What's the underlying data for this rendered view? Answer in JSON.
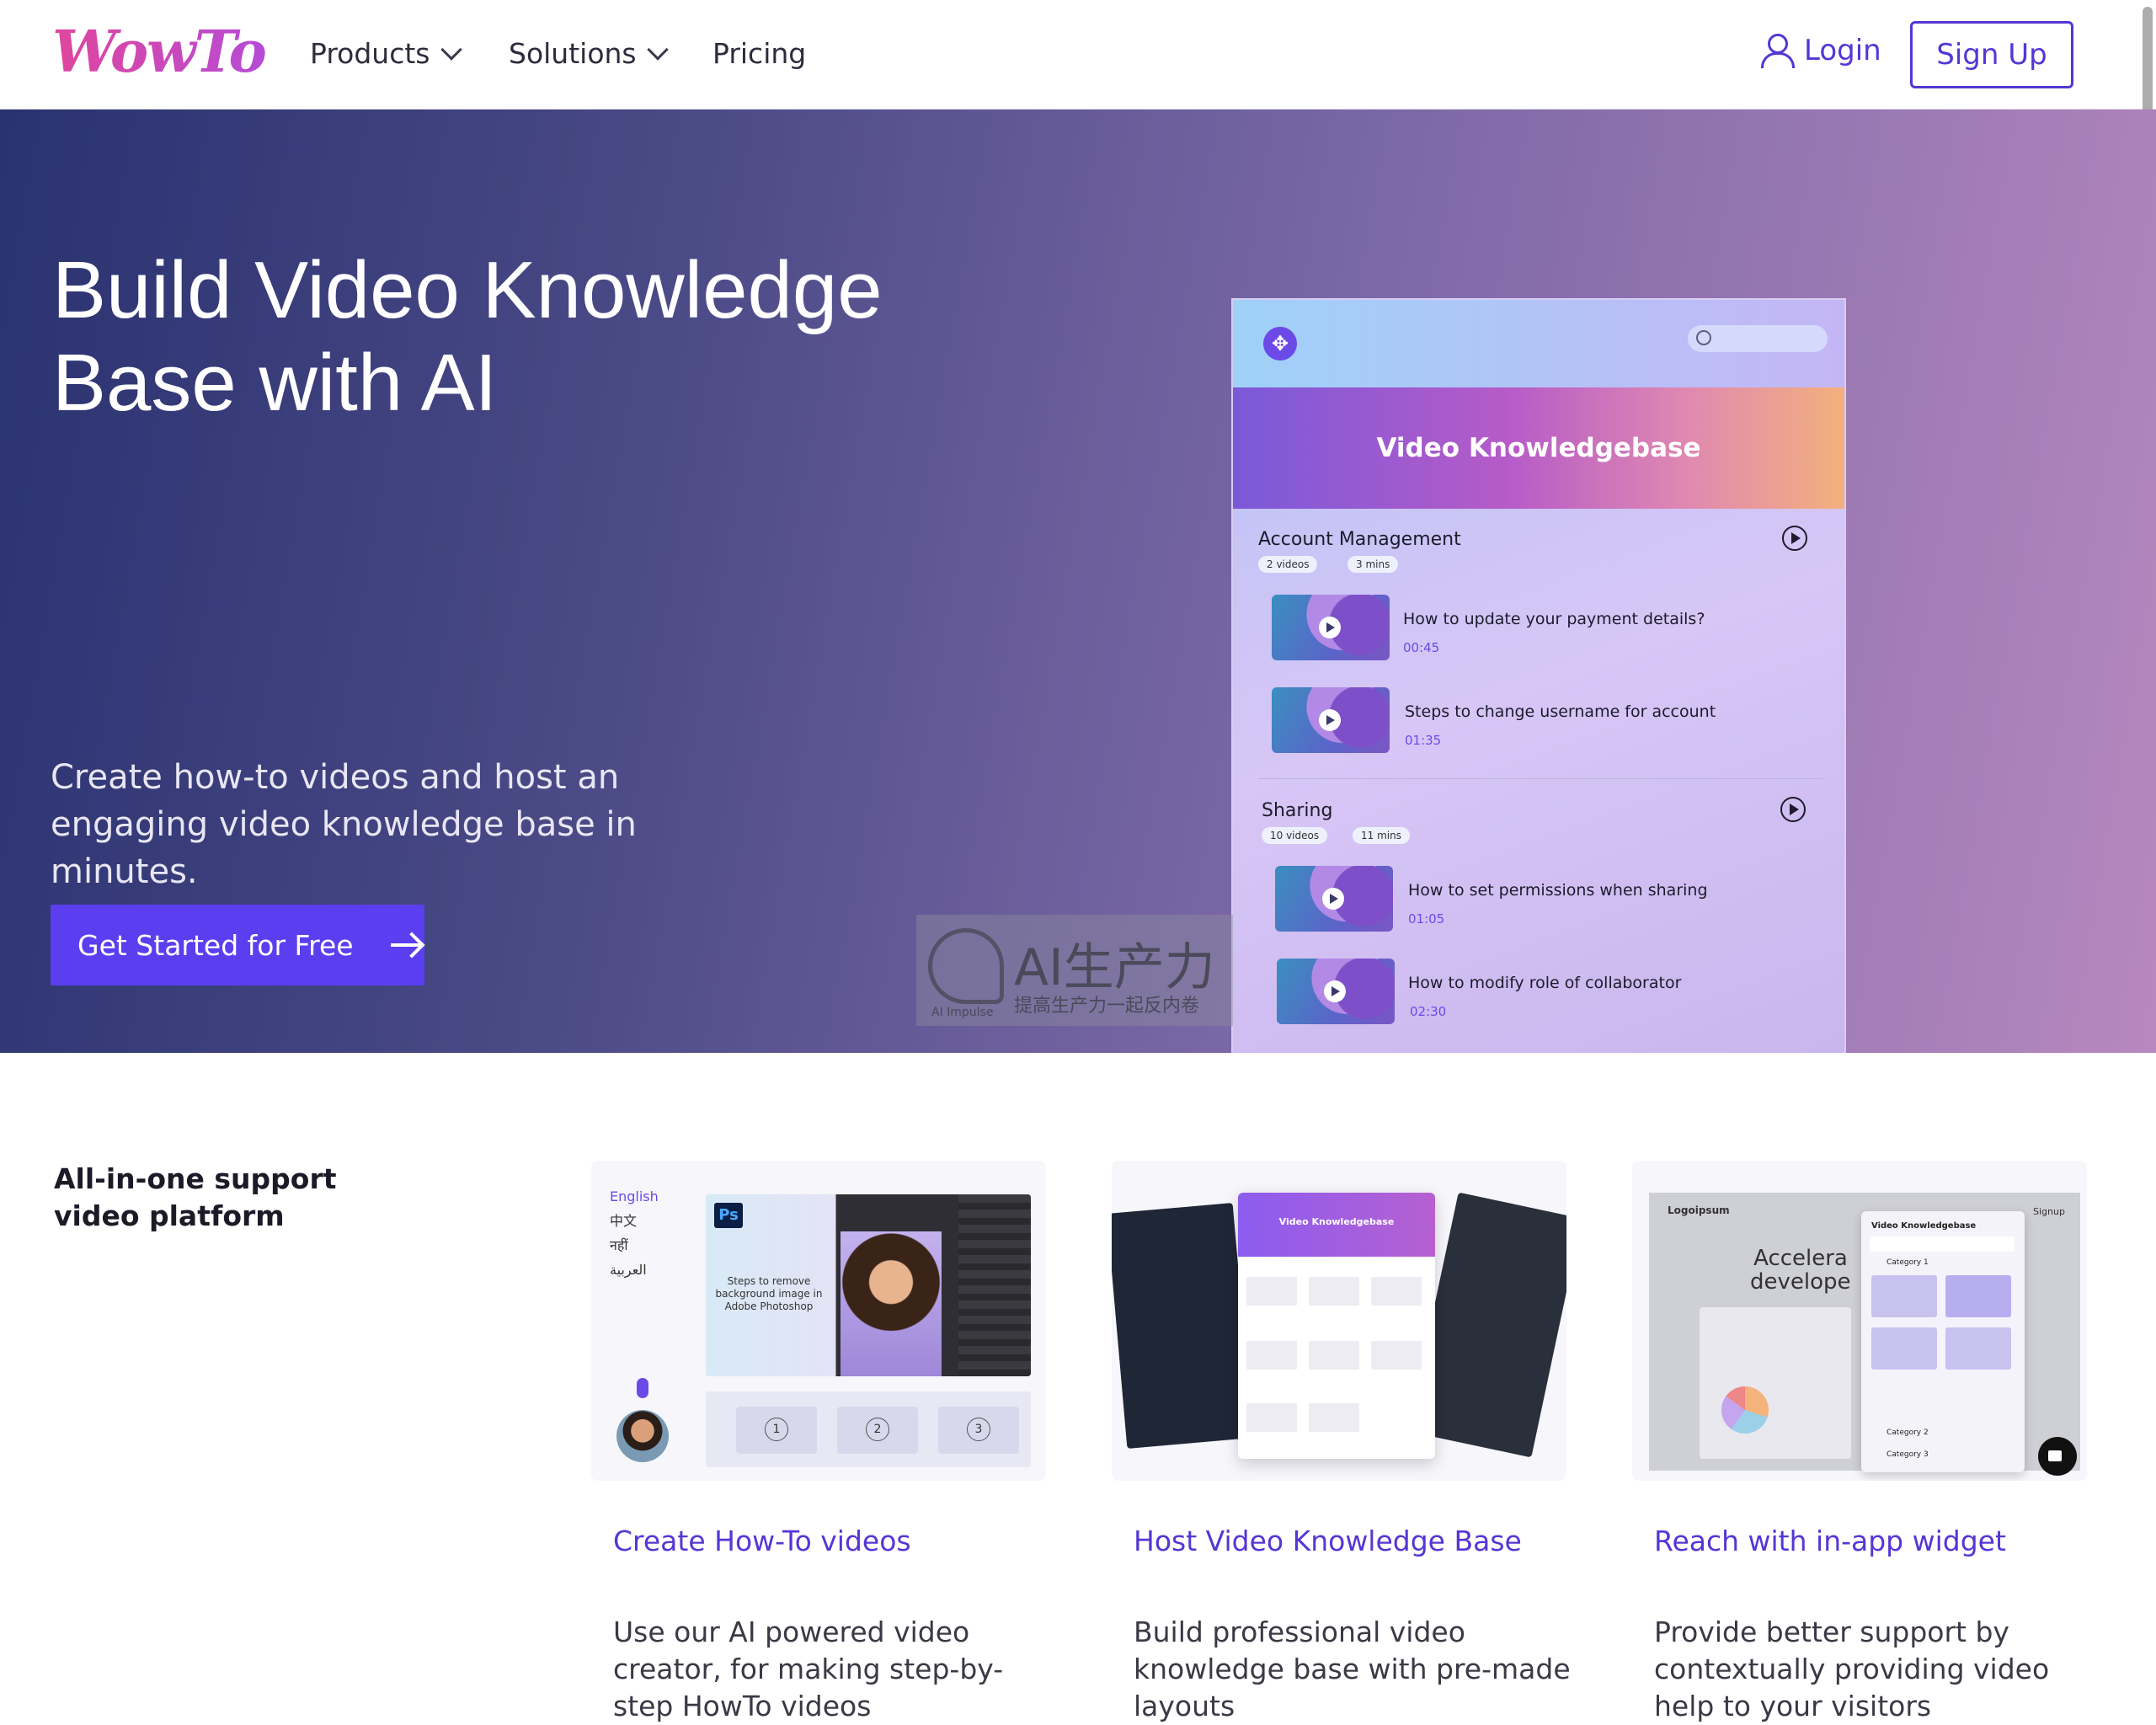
{
  "nav": {
    "logo": "WowTo",
    "items": [
      "Products",
      "Solutions",
      "Pricing"
    ],
    "login": "Login",
    "signup": "Sign Up"
  },
  "hero": {
    "title": "Build Video Knowledge Base with AI",
    "subtitle": "Create how-to videos and host an engaging video knowledge base in minutes.",
    "cta": "Get Started for Free"
  },
  "mock": {
    "banner": "Video Knowledgebase",
    "sections": [
      {
        "title": "Account Management",
        "videos_chip": "2 videos",
        "time_chip": "3 mins",
        "items": [
          {
            "title": "How to update your payment details?",
            "time": "00:45"
          },
          {
            "title": "Steps to change username for account",
            "time": "01:35"
          }
        ]
      },
      {
        "title": "Sharing",
        "videos_chip": "10 videos",
        "time_chip": "11 mins",
        "items": [
          {
            "title": "How to set permissions when sharing",
            "time": "01:05"
          },
          {
            "title": "How to modify role of collaborator",
            "time": "02:30"
          }
        ]
      }
    ]
  },
  "watermark": {
    "big": "AI生产力",
    "small": "提高生产力一起反内卷",
    "tiny": "AI Impulse"
  },
  "features": {
    "heading": "All-in-one support video platform",
    "cards": [
      {
        "title": "Create How-To videos",
        "desc": "Use our AI powered video creator, for making step-by-step HowTo videos",
        "langs": [
          "English",
          "中文",
          "नहीं",
          "العربية"
        ],
        "ps_badge": "Ps",
        "ps_text": "Steps to remove background image in Adobe Photoshop",
        "steps": [
          "1",
          "2",
          "3"
        ]
      },
      {
        "title": "Host Video Knowledge Base",
        "desc": "Build professional video knowledge base with pre-made layouts",
        "kb_header": "Video Knowledgebase"
      },
      {
        "title": "Reach with in-app widget",
        "desc": "Provide better support by contextually providing video help to your visitors",
        "brand": "Logoipsum",
        "signup": "Signup",
        "bg_text": "Accelera developer",
        "panel_title": "Video Knowledgebase",
        "categories": [
          "Category 1",
          "Category 2",
          "Category 3"
        ]
      }
    ]
  }
}
